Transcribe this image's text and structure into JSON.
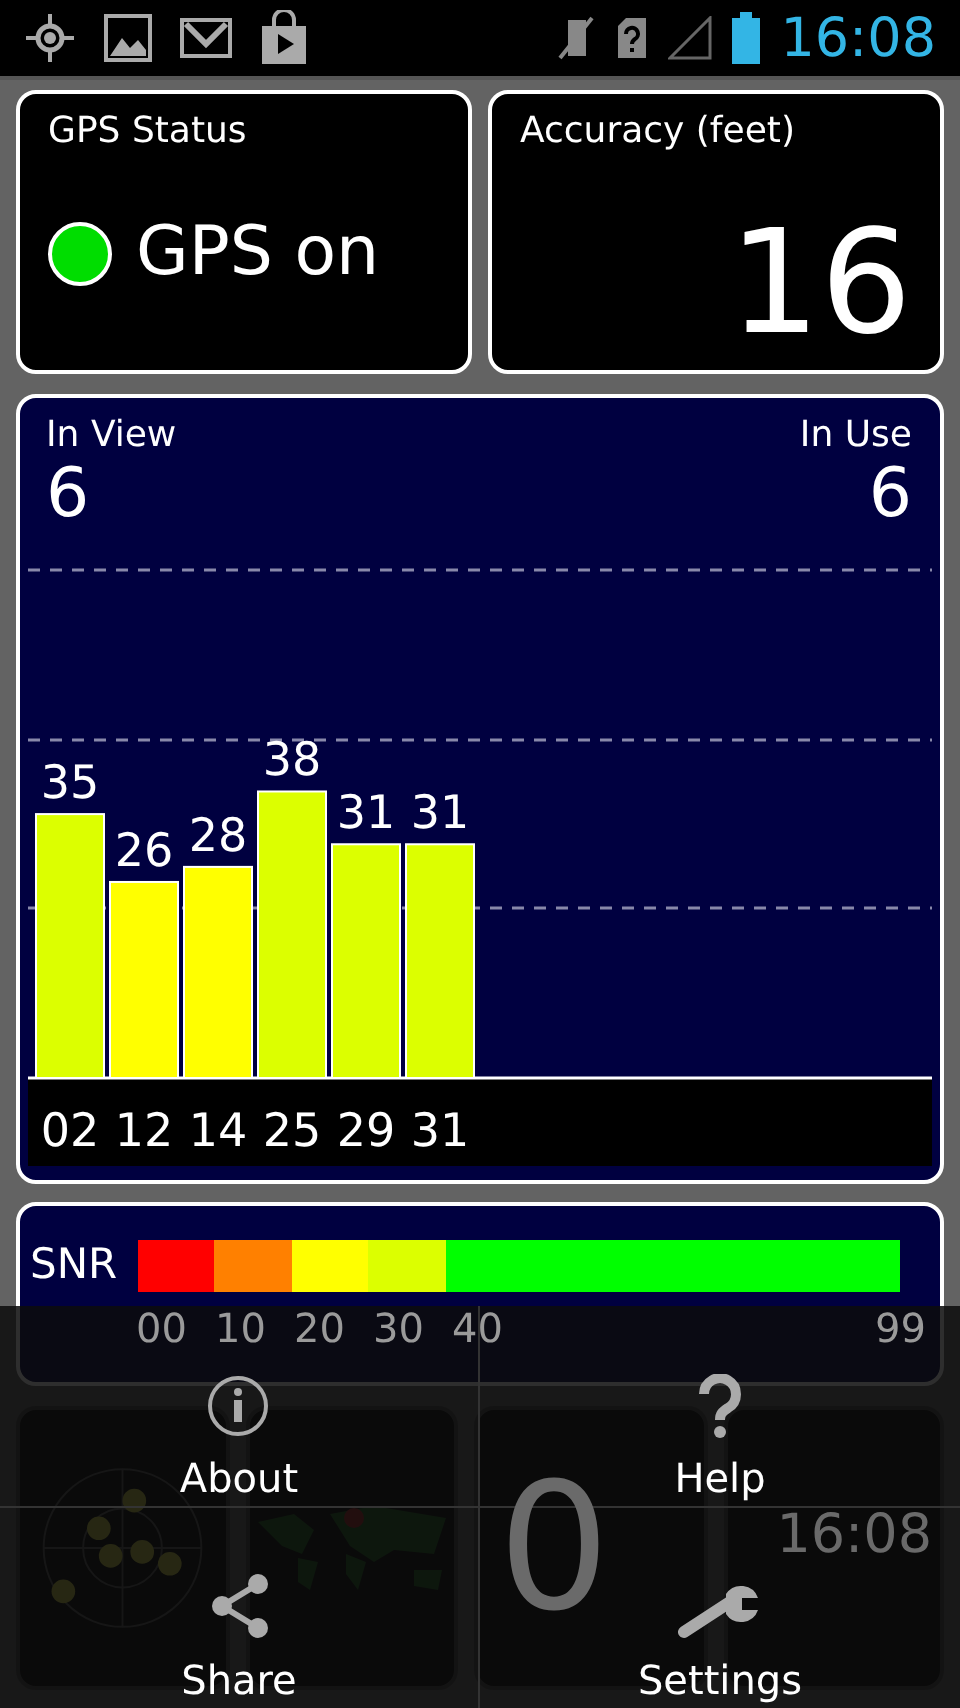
{
  "status_bar": {
    "time": "16:08"
  },
  "gps_status": {
    "title": "GPS Status",
    "on": true,
    "text": "GPS on"
  },
  "accuracy": {
    "title": "Accuracy (feet)",
    "value": "16"
  },
  "satellites": {
    "in_view_label": "In View",
    "in_view": "6",
    "in_use_label": "In Use",
    "in_use": "6",
    "chart_data": {
      "type": "bar",
      "categories": [
        "02",
        "12",
        "14",
        "25",
        "29",
        "31"
      ],
      "values": [
        35,
        26,
        28,
        38,
        31,
        31
      ],
      "data_labels": true
    }
  },
  "snr": {
    "label": "SNR",
    "segments": [
      {
        "label": "00",
        "color": "#ff0000"
      },
      {
        "label": "10",
        "color": "#ff8000"
      },
      {
        "label": "20",
        "color": "#ffff00"
      },
      {
        "label": "30",
        "color": "#dcff00"
      },
      {
        "label": "40",
        "color": "#00ff00"
      }
    ],
    "end_label": "99"
  },
  "widgets": {
    "speed": "0",
    "clock": "16:08"
  },
  "menu": [
    {
      "kind": "info",
      "label": "About"
    },
    {
      "kind": "help",
      "label": "Help"
    },
    {
      "kind": "share",
      "label": "Share"
    },
    {
      "kind": "settings",
      "label": "Settings"
    }
  ]
}
